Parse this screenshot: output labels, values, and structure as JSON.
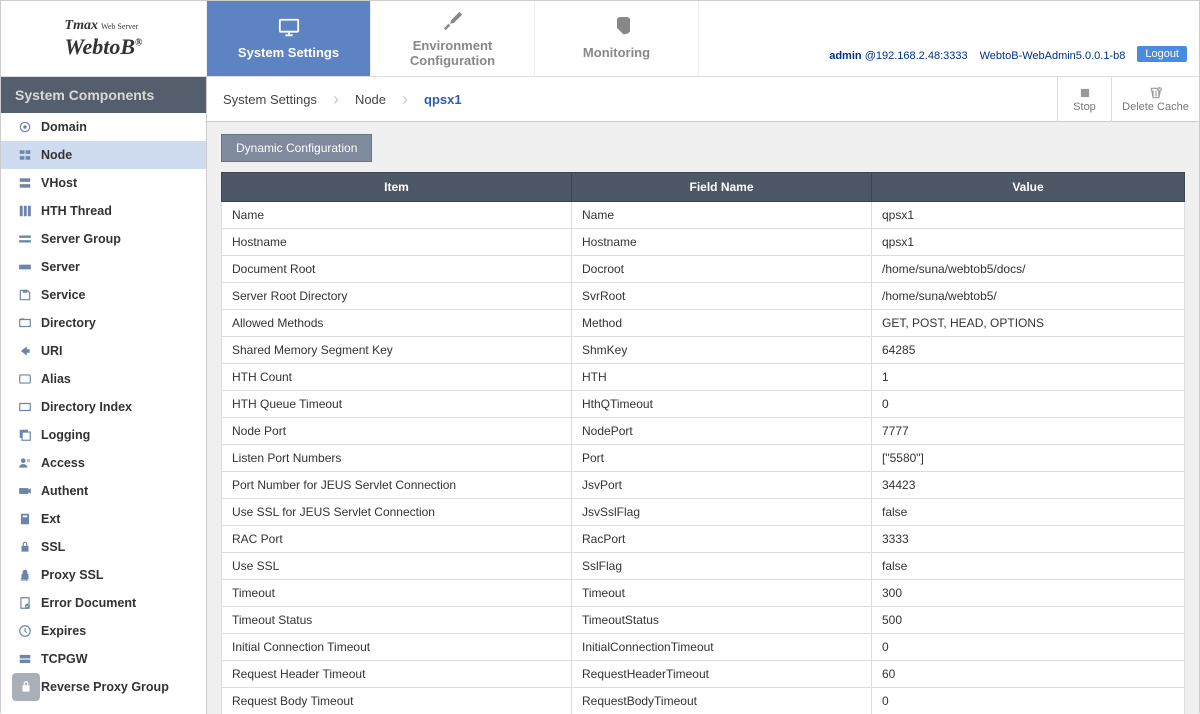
{
  "logo": {
    "brand_top": "Tmax",
    "brand_sub": "Web Server",
    "brand_main": "WebtoB",
    "reg": "®"
  },
  "nav": {
    "tabs": [
      {
        "label": "System Settings"
      },
      {
        "label": "Environment Configuration"
      },
      {
        "label": "Monitoring"
      }
    ]
  },
  "header_right": {
    "admin": "admin",
    "host": "@192.168.2.48:3333",
    "version": "WebtoB-WebAdmin5.0.0.1-b8",
    "logout": "Logout"
  },
  "sidebar": {
    "title": "System Components",
    "items": [
      {
        "label": "Domain"
      },
      {
        "label": "Node"
      },
      {
        "label": "VHost"
      },
      {
        "label": "HTH Thread"
      },
      {
        "label": "Server Group"
      },
      {
        "label": "Server"
      },
      {
        "label": "Service"
      },
      {
        "label": "Directory"
      },
      {
        "label": "URI"
      },
      {
        "label": "Alias"
      },
      {
        "label": "Directory Index"
      },
      {
        "label": "Logging"
      },
      {
        "label": "Access"
      },
      {
        "label": "Authent"
      },
      {
        "label": "Ext"
      },
      {
        "label": "SSL"
      },
      {
        "label": "Proxy SSL"
      },
      {
        "label": "Error Document"
      },
      {
        "label": "Expires"
      },
      {
        "label": "TCPGW"
      },
      {
        "label": "Reverse Proxy Group"
      }
    ]
  },
  "breadcrumb": {
    "a": "System Settings",
    "b": "Node",
    "c": "qpsx1"
  },
  "actions": {
    "stop": "Stop",
    "delete_cache": "Delete Cache"
  },
  "panel": {
    "button": "Dynamic Configuration",
    "columns": {
      "item": "Item",
      "field": "Field Name",
      "value": "Value"
    },
    "rows": [
      {
        "item": "Name",
        "field": "Name",
        "value": "qpsx1"
      },
      {
        "item": "Hostname",
        "field": "Hostname",
        "value": "qpsx1"
      },
      {
        "item": "Document Root",
        "field": "Docroot",
        "value": "/home/suna/webtob5/docs/"
      },
      {
        "item": "Server Root Directory",
        "field": "SvrRoot",
        "value": "/home/suna/webtob5/"
      },
      {
        "item": "Allowed Methods",
        "field": "Method",
        "value": "GET, POST, HEAD, OPTIONS"
      },
      {
        "item": "Shared Memory Segment Key",
        "field": "ShmKey",
        "value": "64285"
      },
      {
        "item": "HTH Count",
        "field": "HTH",
        "value": "1"
      },
      {
        "item": "HTH Queue Timeout",
        "field": "HthQTimeout",
        "value": "0"
      },
      {
        "item": "Node Port",
        "field": "NodePort",
        "value": "7777"
      },
      {
        "item": "Listen Port Numbers",
        "field": "Port",
        "value": "[\"5580\"]"
      },
      {
        "item": "Port Number for JEUS Servlet Connection",
        "field": "JsvPort",
        "value": "34423"
      },
      {
        "item": "Use SSL for JEUS Servlet Connection",
        "field": "JsvSslFlag",
        "value": "false"
      },
      {
        "item": "RAC Port",
        "field": "RacPort",
        "value": "3333"
      },
      {
        "item": "Use SSL",
        "field": "SslFlag",
        "value": "false"
      },
      {
        "item": "Timeout",
        "field": "Timeout",
        "value": "300"
      },
      {
        "item": "Timeout Status",
        "field": "TimeoutStatus",
        "value": "500"
      },
      {
        "item": "Initial Connection Timeout",
        "field": "InitialConnectionTimeout",
        "value": "0"
      },
      {
        "item": "Request Header Timeout",
        "field": "RequestHeaderTimeout",
        "value": "60"
      },
      {
        "item": "Request Body Timeout",
        "field": "RequestBodyTimeout",
        "value": "0"
      }
    ]
  }
}
